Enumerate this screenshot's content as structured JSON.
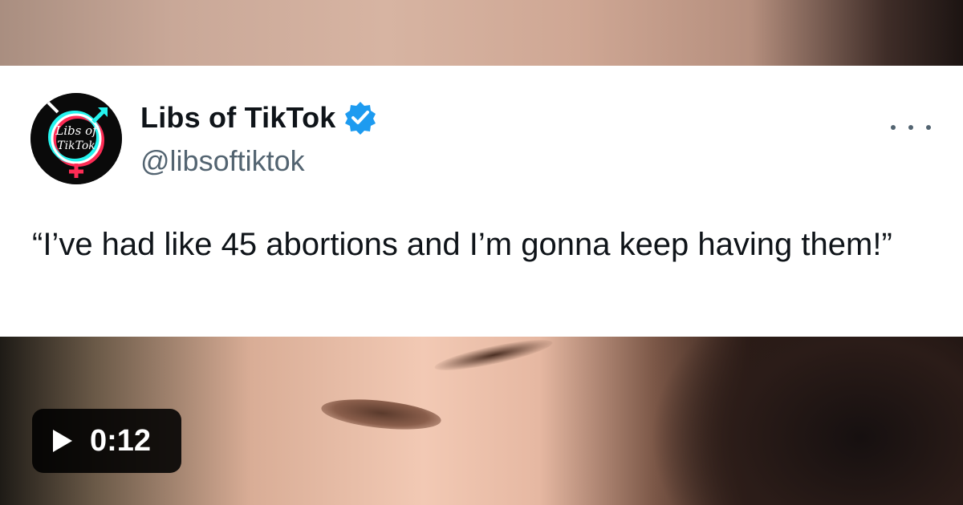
{
  "tweet": {
    "display_name": "Libs of TikTok",
    "handle": "@libsoftiktok",
    "verified": true,
    "verified_color": "#1d9bf0",
    "text": "“I’ve had like 45 abortions and I’m gonna keep having them!”",
    "avatar": {
      "line1": "Libs of",
      "line2": "TikTok",
      "ring_colors": [
        "#25f4ee",
        "#fe2c55"
      ]
    },
    "more_icon": "more-horizontal-icon"
  },
  "video": {
    "duration": "0:12",
    "play_icon": "play-icon"
  }
}
